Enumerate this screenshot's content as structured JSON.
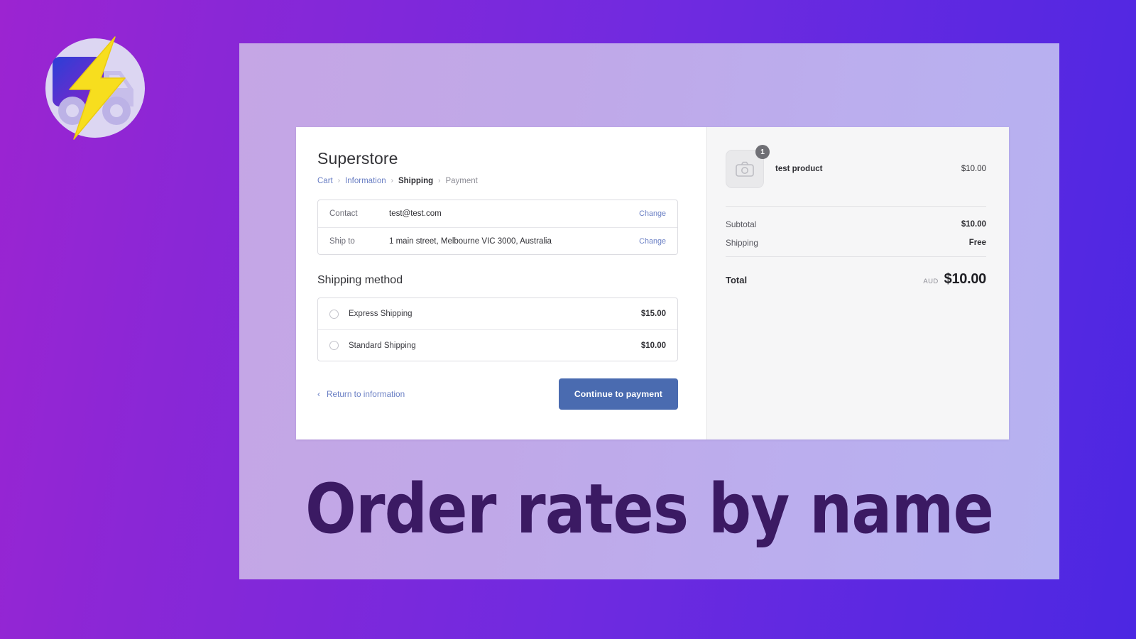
{
  "brand": {
    "logo_icon": "lightning-truck-logo"
  },
  "caption": "Order rates by name",
  "checkout": {
    "store_title": "Superstore",
    "breadcrumb": [
      {
        "label": "Cart",
        "state": "link"
      },
      {
        "label": "Information",
        "state": "link"
      },
      {
        "label": "Shipping",
        "state": "active"
      },
      {
        "label": "Payment",
        "state": "muted"
      }
    ],
    "breadcrumb_separator": "›",
    "info_rows": [
      {
        "label": "Contact",
        "value": "test@test.com",
        "action": "Change"
      },
      {
        "label": "Ship to",
        "value": "1 main street, Melbourne VIC 3000, Australia",
        "action": "Change"
      }
    ],
    "shipping_section_title": "Shipping method",
    "shipping_rates": [
      {
        "name": "Express Shipping",
        "price": "$15.00",
        "selected": false
      },
      {
        "name": "Standard Shipping",
        "price": "$10.00",
        "selected": false
      }
    ],
    "return_link": "Return to information",
    "return_chevron": "‹",
    "continue_button": "Continue to payment",
    "button_color": "#4A6BB0"
  },
  "summary": {
    "item": {
      "name": "test product",
      "price": "$10.00",
      "quantity": "1",
      "thumb_icon": "camera-placeholder-icon"
    },
    "rows": [
      {
        "label": "Subtotal",
        "value": "$10.00"
      },
      {
        "label": "Shipping",
        "value": "Free"
      }
    ],
    "total_label": "Total",
    "total_currency": "AUD",
    "total_value": "$10.00"
  }
}
